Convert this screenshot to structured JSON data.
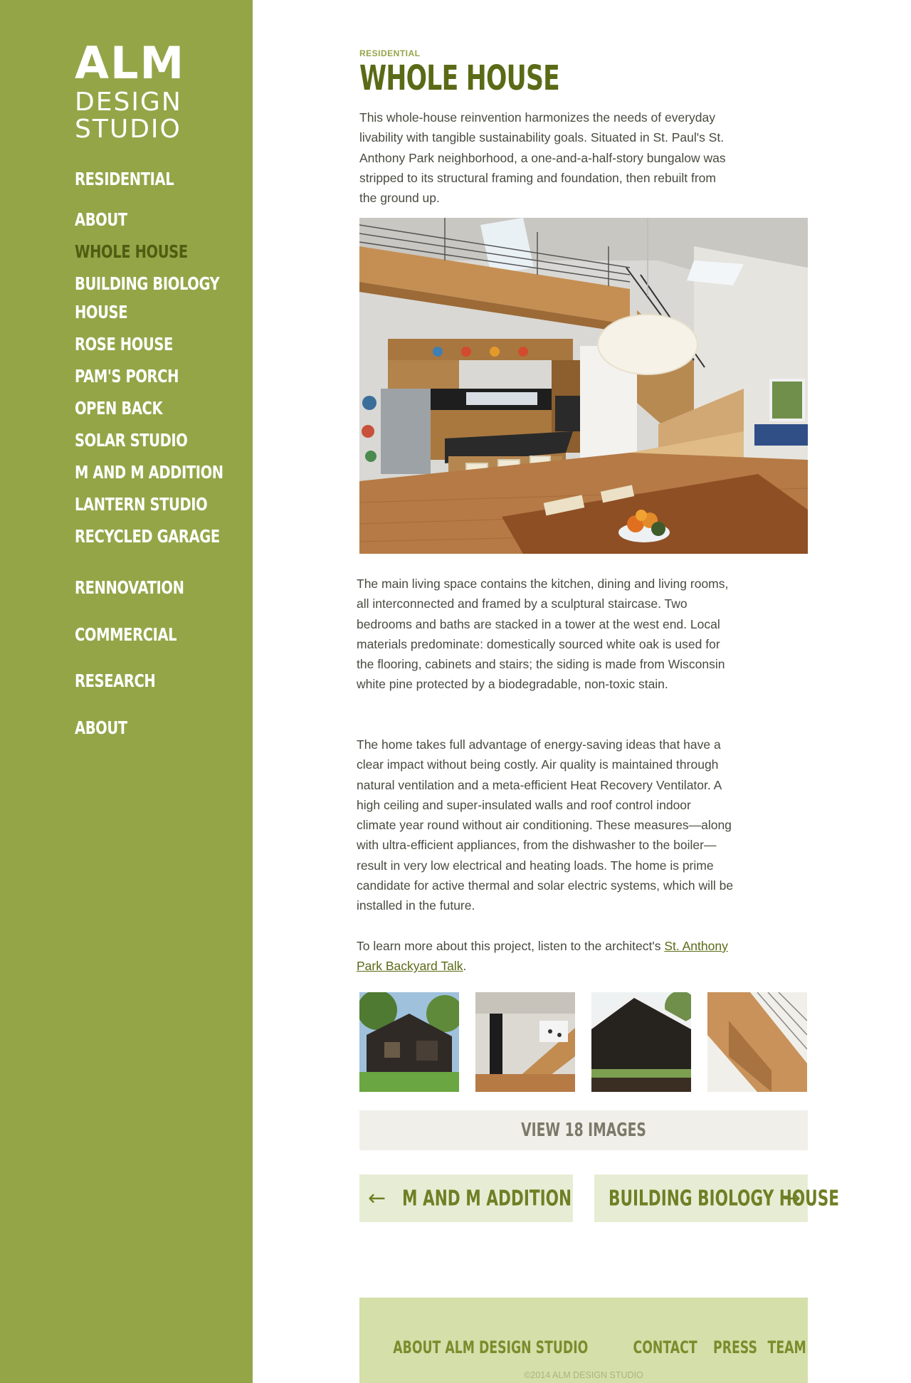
{
  "logo": {
    "line1": "ALM",
    "line2": "DESIGN",
    "line3": "STUDIO"
  },
  "nav": {
    "residential": "RESIDENTIAL",
    "sub": [
      "ABOUT",
      "WHOLE HOUSE",
      "BUILDING BIOLOGY",
      "HOUSE",
      "ROSE HOUSE",
      "PAM'S PORCH",
      "OPEN BACK",
      "SOLAR STUDIO",
      "M AND M ADDITION",
      "LANTERN STUDIO",
      "RECYCLED GARAGE"
    ],
    "rennovation": "RENNOVATION",
    "commercial": "COMMERCIAL",
    "research": "RESEARCH",
    "about": "ABOUT"
  },
  "page": {
    "kicker": "RESIDENTIAL",
    "title": "WHOLE HOUSE",
    "intro": "This whole-house reinvention harmonizes the needs of everyday livability with tangible sustainability goals. Situated in St. Paul's St. Anthony Park neighborhood, a one-and-a-half-story bungalow was stripped to its structural framing and foundation, then rebuilt from the ground up.",
    "body1": "The main living space contains the kitchen, dining and living rooms, all interconnected and framed by a sculptural staircase. Two bedrooms and baths are stacked in a tower at the west end. Local materials predominate: domestically sourced white oak is used for the flooring, cabinets and stairs; the siding is made from Wisconsin white pine protected by a biodegradable, non-toxic stain.",
    "body2": "The home takes full advantage of energy-saving ideas that have a clear impact without being costly. Air quality is maintained through natural ventilation and a meta-efficient Heat Recovery Ventilator. A high ceiling and super-insulated walls and roof control indoor climate year round without air conditioning. These measures—along with ultra-efficient appliances, from the dishwasher to the boiler—result in very low electrical and heating loads. The home is prime candidate for active thermal and solar electric systems, which will be installed in the future.",
    "learn_prefix": "To learn more about this project, listen to the architect's ",
    "learn_link": "St. Anthony Park Backyard Talk",
    "learn_suffix": "."
  },
  "gallery": {
    "view_label": "VIEW 18 IMAGES"
  },
  "pager": {
    "prev_arrow": "←",
    "prev_label": "M AND M ADDITION",
    "next_label": "BUILDING BIOLOGY HOUSE",
    "next_arrow": "→"
  },
  "footer": {
    "links": [
      "ABOUT ALM DESIGN STUDIO",
      "CONTACT",
      "PRESS",
      "TEAM"
    ],
    "copyright": "©2014 ALM DESIGN STUDIO"
  },
  "colors": {
    "sidebar": "#94a548",
    "active_nav": "#4d5e12",
    "title": "#5a6a16",
    "pager_bg": "#e7edd4",
    "footer_bg": "#d4dfaa"
  }
}
